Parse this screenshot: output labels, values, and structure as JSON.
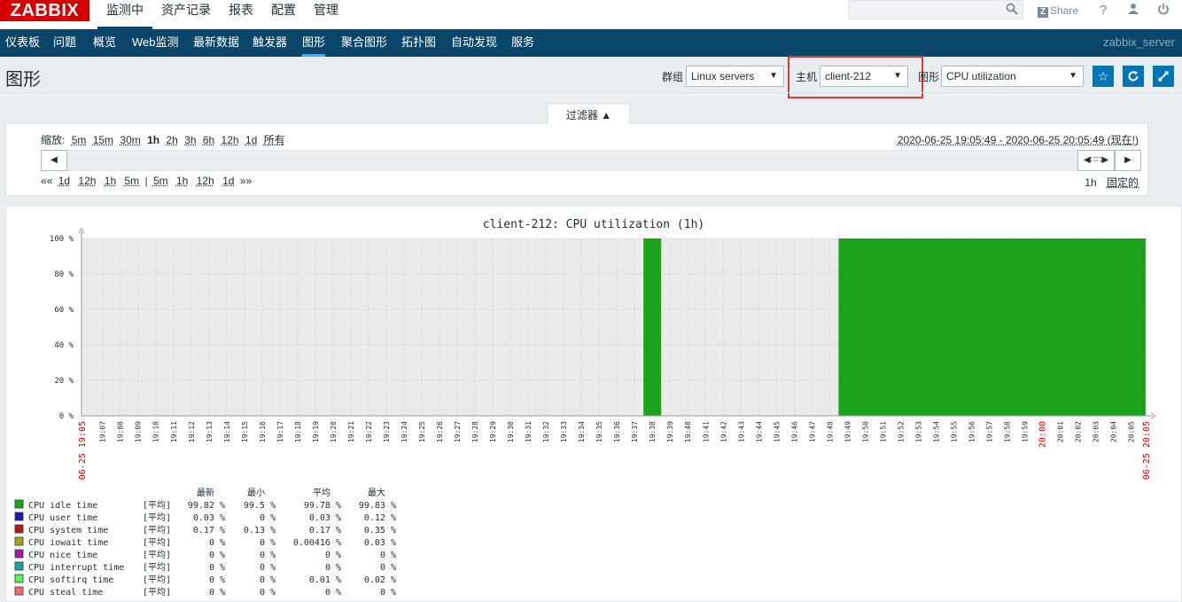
{
  "top": {
    "logo": "ZABBIX",
    "menu": [
      "监测中",
      "资产记录",
      "报表",
      "配置",
      "管理"
    ],
    "share_label": "Share",
    "icons": [
      "search-icon",
      "help-icon",
      "user-icon",
      "power-icon"
    ]
  },
  "submenu": {
    "items": [
      "仪表板",
      "问题",
      "概览",
      "Web监测",
      "最新数据",
      "触发器",
      "图形",
      "聚合图形",
      "拓扑图",
      "自动发现",
      "服务"
    ],
    "active": "图形",
    "server": "zabbix_server"
  },
  "header": {
    "title": "图形",
    "group_label": "群组",
    "group_value": "Linux servers",
    "host_label": "主机",
    "host_value": "client-212",
    "graph_label": "图形",
    "graph_value": "CPU utilization"
  },
  "filter": {
    "tab_label": "过滤器 ▲",
    "zoom_label": "缩放:",
    "zoom_options": [
      "5m",
      "15m",
      "30m",
      "1h",
      "2h",
      "3h",
      "6h",
      "12h",
      "1d",
      "所有"
    ],
    "zoom_active": "1h",
    "period": "2020-06-25 19:05:49 - 2020-06-25 20:05:49 (现在!)",
    "nav_left": [
      "1d",
      "12h",
      "1h",
      "5m"
    ],
    "nav_right": [
      "5m",
      "1h",
      "12h",
      "1d"
    ],
    "nav_first": "««",
    "nav_last": "»»",
    "nav_sep": "|",
    "duration": "1h",
    "fixed_label": "固定的"
  },
  "chart_data": {
    "type": "area",
    "title": "client-212: CPU utilization (1h)",
    "y_ticks": [
      "100 %",
      "80 %",
      "60 %",
      "40 %",
      "20 %",
      "0 %"
    ],
    "ylim": [
      0,
      100
    ],
    "x_start_label": "06-25 19:05",
    "x_end_label": "06-25 20:05",
    "x_ticks": [
      "19:07",
      "19:08",
      "19:09",
      "19:10",
      "19:11",
      "19:12",
      "19:13",
      "19:14",
      "19:15",
      "19:16",
      "19:17",
      "19:18",
      "19:19",
      "19:20",
      "19:21",
      "19:22",
      "19:23",
      "19:24",
      "19:25",
      "19:26",
      "19:27",
      "19:28",
      "19:29",
      "19:30",
      "19:31",
      "19:32",
      "19:33",
      "19:34",
      "19:35",
      "19:36",
      "19:37",
      "19:38",
      "19:39",
      "19:40",
      "19:41",
      "19:42",
      "19:43",
      "19:44",
      "19:45",
      "19:46",
      "19:47",
      "19:48",
      "19:49",
      "19:50",
      "19:51",
      "19:52",
      "19:53",
      "19:54",
      "19:55",
      "19:56",
      "19:57",
      "19:58",
      "19:59",
      "20:00",
      "20:01",
      "20:02",
      "20:03",
      "20:04",
      "20:05"
    ],
    "x_red_ticks": [
      "20:00"
    ],
    "data_blocks": [
      {
        "from": "19:37:30",
        "to": "19:38:30",
        "value": 100
      },
      {
        "from": "19:48:30",
        "to": "20:05:49",
        "value": 100
      }
    ],
    "legend_headers": [
      "最新",
      "最小",
      "平均",
      "最大"
    ],
    "series": [
      {
        "name": "CPU idle time",
        "color": "#1aa31a",
        "fn": "[平均]",
        "values": [
          "99.82 %",
          "99.5 %",
          "99.78 %",
          "99.83 %"
        ]
      },
      {
        "name": "CPU user time",
        "color": "#1a1ab3",
        "fn": "[平均]",
        "values": [
          "0.03 %",
          "0 %",
          "0.03 %",
          "0.12 %"
        ]
      },
      {
        "name": "CPU system time",
        "color": "#b31a1a",
        "fn": "[平均]",
        "values": [
          "0.17 %",
          "0.13 %",
          "0.17 %",
          "0.35 %"
        ]
      },
      {
        "name": "CPU iowait time",
        "color": "#a3a31a",
        "fn": "[平均]",
        "values": [
          "0 %",
          "0 %",
          "0.00416 %",
          "0.03 %"
        ]
      },
      {
        "name": "CPU nice time",
        "color": "#a31aa3",
        "fn": "[平均]",
        "values": [
          "0 %",
          "0 %",
          "0 %",
          "0 %"
        ]
      },
      {
        "name": "CPU interrupt time",
        "color": "#1aa3a3",
        "fn": "[平均]",
        "values": [
          "0 %",
          "0 %",
          "0 %",
          "0 %"
        ]
      },
      {
        "name": "CPU softirq time",
        "color": "#5cf05c",
        "fn": "[平均]",
        "values": [
          "0 %",
          "0 %",
          "0.01 %",
          "0.02 %"
        ]
      },
      {
        "name": "CPU steal time",
        "color": "#f06c6c",
        "fn": "[平均]",
        "values": [
          "0 %",
          "0 %",
          "0 %",
          "0 %"
        ]
      }
    ]
  }
}
